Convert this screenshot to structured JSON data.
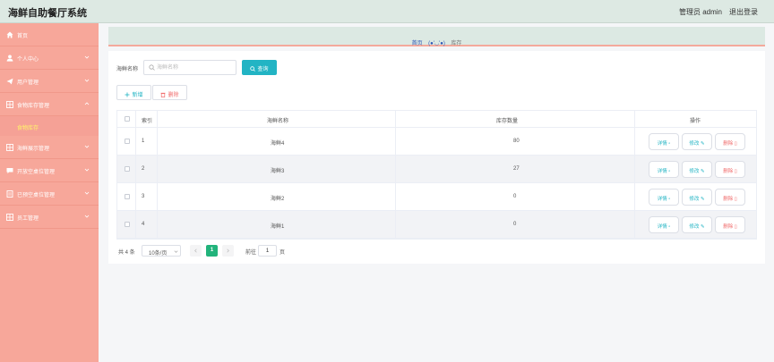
{
  "header": {
    "title": "海鲜自助餐厅系统",
    "user": "管理员 admin",
    "logout": "退出登录"
  },
  "sidebar": {
    "items": [
      {
        "label": "首页",
        "icon": "home-icon",
        "expandable": false
      },
      {
        "label": "个人中心",
        "icon": "user-icon",
        "expandable": true
      },
      {
        "label": "用户管理",
        "icon": "send-icon",
        "expandable": true
      },
      {
        "label": "食物库存管理",
        "icon": "grid-icon",
        "expandable": true,
        "active": true,
        "children": [
          {
            "label": "食物库存"
          }
        ]
      },
      {
        "label": "海鲜展示管理",
        "icon": "grid-icon",
        "expandable": true
      },
      {
        "label": "开放空桌位管理",
        "icon": "chat-icon",
        "expandable": true
      },
      {
        "label": "已预空桌位管理",
        "icon": "doc-icon",
        "expandable": true
      },
      {
        "label": "员工管理",
        "icon": "grid-icon",
        "expandable": true
      }
    ]
  },
  "breadcrumb": {
    "home": "首页",
    "emoticon": "(●'◡'●)",
    "current": "库存"
  },
  "search": {
    "label": "海鲜名称",
    "placeholder": "海鲜名称",
    "button": "查询"
  },
  "toolbar": {
    "add": "新增",
    "delete": "删除"
  },
  "table": {
    "columns": [
      "索引",
      "海鲜名称",
      "库存数量",
      "操作"
    ],
    "actions": {
      "detail": "详情",
      "edit": "修改",
      "remove": "删除"
    },
    "rows": [
      {
        "index": "1",
        "name": "海鲜4",
        "qty": "80"
      },
      {
        "index": "2",
        "name": "海鲜3",
        "qty": "27"
      },
      {
        "index": "3",
        "name": "海鲜2",
        "qty": "0"
      },
      {
        "index": "4",
        "name": "海鲜1",
        "qty": "0"
      }
    ]
  },
  "pagination": {
    "total": "共 4 条",
    "page_size": "10条/页",
    "current": "1",
    "goto_label": "前往",
    "goto_value": "1",
    "page_suffix": "页"
  },
  "colors": {
    "sidebar": "#f7a79a",
    "accent": "#22b4c4",
    "active_page": "#22b37b",
    "danger": "#f06a6a",
    "submenu_text": "#fff46a"
  }
}
